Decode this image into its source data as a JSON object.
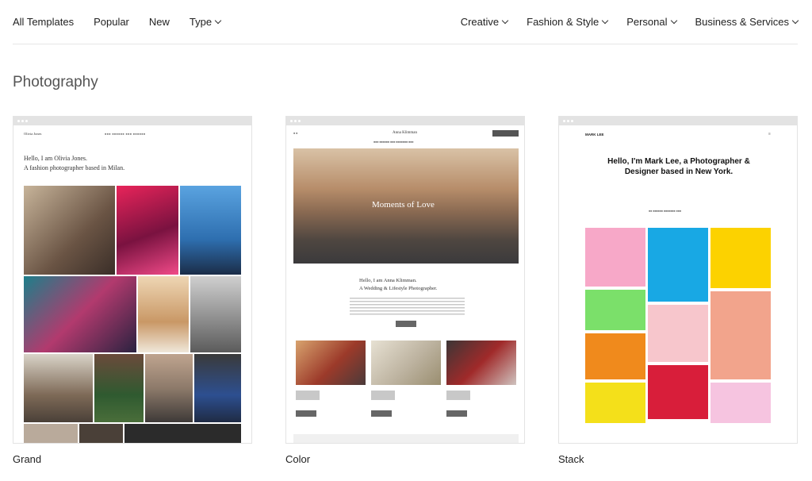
{
  "nav": {
    "left": [
      {
        "label": "All Templates"
      },
      {
        "label": "Popular"
      },
      {
        "label": "New"
      },
      {
        "label": "Type",
        "dropdown": true
      }
    ],
    "right": [
      {
        "label": "Creative",
        "dropdown": true
      },
      {
        "label": "Fashion & Style",
        "dropdown": true
      },
      {
        "label": "Personal",
        "dropdown": true
      },
      {
        "label": "Business & Services",
        "dropdown": true
      }
    ]
  },
  "section": {
    "title": "Photography"
  },
  "templates": [
    {
      "name": "Grand",
      "preview": {
        "site_name": "Olivia Jones",
        "heading_line1": "Hello, I am Olivia Jones.",
        "heading_line2": "A fashion photographer based in Milan."
      }
    },
    {
      "name": "Color",
      "preview": {
        "site_name": "Anna Klimman",
        "hero_text": "Moments of Love",
        "heading_line1": "Hello, I am Anna Klimman.",
        "heading_line2": "A Wedding & Lifestyle Photographer."
      }
    },
    {
      "name": "Stack",
      "preview": {
        "site_name": "MARK LEE",
        "heading": "Hello, I'm Mark Lee, a Photographer & Designer based in New York."
      }
    }
  ],
  "colors": {
    "nav_text": "#222222",
    "section_title": "#555555",
    "card_border": "#e3e3e3"
  }
}
